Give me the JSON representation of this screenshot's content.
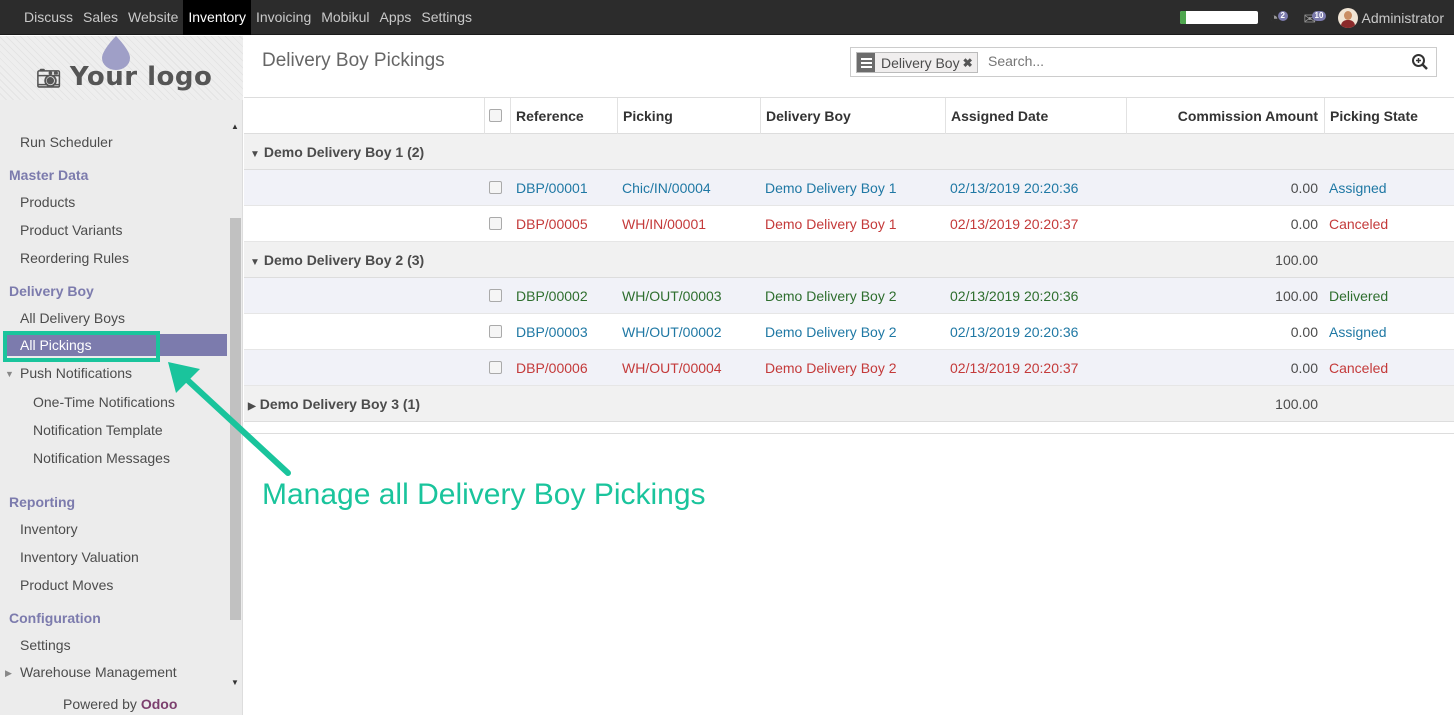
{
  "navbar": {
    "menu": [
      "Discuss",
      "Sales",
      "Website",
      "Inventory",
      "Invoicing",
      "Mobikul",
      "Apps",
      "Settings"
    ],
    "active_index": 3,
    "progress_fraction": 0.08,
    "activity_badge": "2",
    "message_badge": "10",
    "user_name": "Administrator",
    "icons": [
      "activity-icon",
      "chat-icon",
      "avatar"
    ]
  },
  "sidebar": {
    "logo_text": "Your logo",
    "run_scheduler": "Run Scheduler",
    "master_data": {
      "title": "Master Data",
      "items": [
        "Products",
        "Product Variants",
        "Reordering Rules"
      ]
    },
    "delivery_boy": {
      "title": "Delivery Boy",
      "items": [
        "All Delivery Boys",
        "All Pickings"
      ],
      "selected": "All Pickings"
    },
    "push_notifications": {
      "title": "Push Notifications",
      "items": [
        "One-Time Notifications",
        "Notification Template",
        "Notification Messages"
      ]
    },
    "reporting": {
      "title": "Reporting",
      "items": [
        "Inventory",
        "Inventory Valuation",
        "Product Moves"
      ]
    },
    "configuration": {
      "title": "Configuration",
      "items": [
        "Settings",
        "Warehouse Management"
      ]
    },
    "powered_by": "Powered by",
    "powered_brand": "Odoo"
  },
  "control_panel": {
    "breadcrumb": "Delivery Boy Pickings",
    "search": {
      "facet": "Delivery Boy",
      "placeholder": "Search..."
    }
  },
  "table": {
    "columns": [
      "Reference",
      "Picking",
      "Delivery Boy",
      "Assigned Date",
      "Commission Amount",
      "Picking State"
    ],
    "groups": [
      {
        "label": "Demo Delivery Boy 1 (2)",
        "expanded": true,
        "total": "",
        "rows": [
          {
            "reference": "DBP/00001",
            "picking": "Chic/IN/00004",
            "delivery_boy": "Demo Delivery Boy 1",
            "assigned_date": "02/13/2019 20:20:36",
            "commission": "0.00",
            "state": "Assigned",
            "state_color": "#1f78a4"
          },
          {
            "reference": "DBP/00005",
            "picking": "WH/IN/00001",
            "delivery_boy": "Demo Delivery Boy 1",
            "assigned_date": "02/13/2019 20:20:37",
            "commission": "0.00",
            "state": "Canceled",
            "state_color": "#c43a3a"
          }
        ]
      },
      {
        "label": "Demo Delivery Boy 2 (3)",
        "expanded": true,
        "total": "100.00",
        "rows": [
          {
            "reference": "DBP/00002",
            "picking": "WH/OUT/00003",
            "delivery_boy": "Demo Delivery Boy 2",
            "assigned_date": "02/13/2019 20:20:36",
            "commission": "100.00",
            "state": "Delivered",
            "state_color": "#2e6e2e"
          },
          {
            "reference": "DBP/00003",
            "picking": "WH/OUT/00002",
            "delivery_boy": "Demo Delivery Boy 2",
            "assigned_date": "02/13/2019 20:20:36",
            "commission": "0.00",
            "state": "Assigned",
            "state_color": "#1f78a4"
          },
          {
            "reference": "DBP/00006",
            "picking": "WH/OUT/00004",
            "delivery_boy": "Demo Delivery Boy 2",
            "assigned_date": "02/13/2019 20:20:37",
            "commission": "0.00",
            "state": "Canceled",
            "state_color": "#c43a3a"
          }
        ]
      },
      {
        "label": "Demo Delivery Boy 3 (1)",
        "expanded": false,
        "total": "100.00",
        "rows": []
      }
    ]
  },
  "annotation": {
    "text": "Manage all Delivery Boy Pickings",
    "color": "#1ac49c"
  },
  "colors": {
    "brand_purple": "#7c7bad",
    "navbar_bg": "#2c2c2c",
    "assigned": "#1f78a4",
    "canceled": "#c43a3a",
    "delivered": "#2e6e2e"
  }
}
